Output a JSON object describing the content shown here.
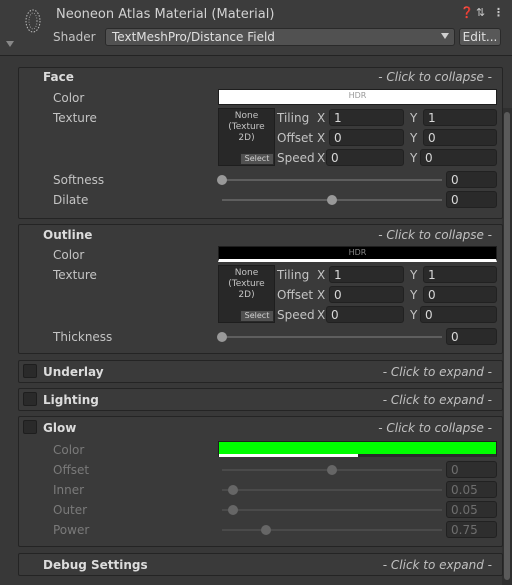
{
  "header": {
    "title": "Neoneon Atlas Material (Material)",
    "shader_label": "Shader",
    "shader_value": "TextMeshPro/Distance Field",
    "edit_button": "Edit...",
    "icons": [
      "help-icon",
      "preset-icon",
      "menu-icon"
    ]
  },
  "face": {
    "title": "Face",
    "hint": "- Click to collapse -",
    "color_label": "Color",
    "color_value": "#ffffff",
    "hdr": "HDR",
    "texture_label": "Texture",
    "texture_none": "None (Texture 2D)",
    "select": "Select",
    "tiling_label": "Tiling",
    "offset_label": "Offset",
    "speed_label": "Speed",
    "x": "X",
    "y": "Y",
    "tiling_x": "1",
    "tiling_y": "1",
    "offset_x": "0",
    "offset_y": "0",
    "speed_x": "0",
    "speed_y": "0",
    "softness_label": "Softness",
    "softness_value": "0",
    "softness_level": 0.0,
    "dilate_label": "Dilate",
    "dilate_value": "0",
    "dilate_level": 0.5
  },
  "outline": {
    "title": "Outline",
    "hint": "- Click to collapse -",
    "color_label": "Color",
    "color_value": "#000000",
    "hdr": "HDR",
    "texture_label": "Texture",
    "texture_none": "None (Texture 2D)",
    "select": "Select",
    "tiling_label": "Tiling",
    "offset_label": "Offset",
    "speed_label": "Speed",
    "x": "X",
    "y": "Y",
    "tiling_x": "1",
    "tiling_y": "1",
    "offset_x": "0",
    "offset_y": "0",
    "speed_x": "0",
    "speed_y": "0",
    "thickness_label": "Thickness",
    "thickness_value": "0",
    "thickness_level": 0.0
  },
  "underlay": {
    "title": "Underlay",
    "hint": "- Click to expand -",
    "enabled": false
  },
  "lighting": {
    "title": "Lighting",
    "hint": "- Click to expand -",
    "enabled": false
  },
  "glow": {
    "title": "Glow",
    "hint": "- Click to collapse -",
    "enabled": false,
    "color_label": "Color",
    "color_value": "#00ff00",
    "offset_label": "Offset",
    "offset_value": "0",
    "offset_level": 0.5,
    "inner_label": "Inner",
    "inner_value": "0.05",
    "inner_level": 0.05,
    "outer_label": "Outer",
    "outer_value": "0.05",
    "outer_level": 0.05,
    "power_label": "Power",
    "power_value": "0.75",
    "power_level": 0.2
  },
  "debug": {
    "title": "Debug Settings",
    "hint": "- Click to expand -"
  }
}
